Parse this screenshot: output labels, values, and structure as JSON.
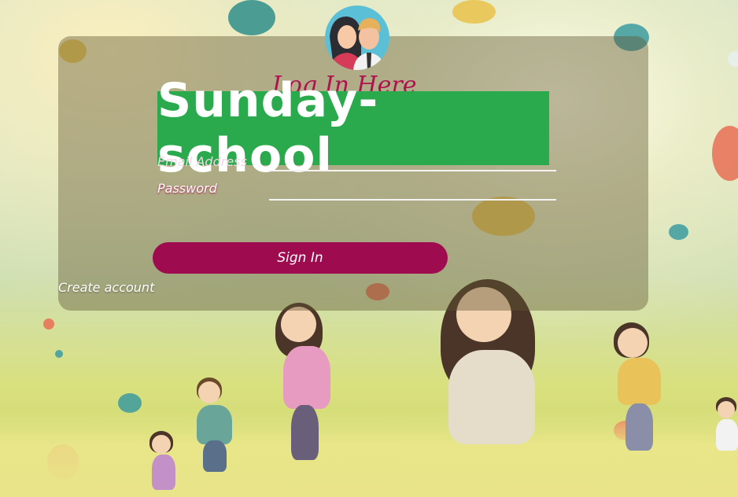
{
  "brand": {
    "banner_text": "Sunday-school"
  },
  "login": {
    "heading": "Log In Here",
    "email_label": "Email Address",
    "password_label": "Password",
    "signin_label": "Sign In",
    "create_account_label": "Create account"
  },
  "colors": {
    "banner": "#2aaa4d",
    "accent": "#9e0b4f",
    "avatar_bg": "#5bc0d6"
  },
  "icons": {
    "avatar": "users-icon"
  }
}
